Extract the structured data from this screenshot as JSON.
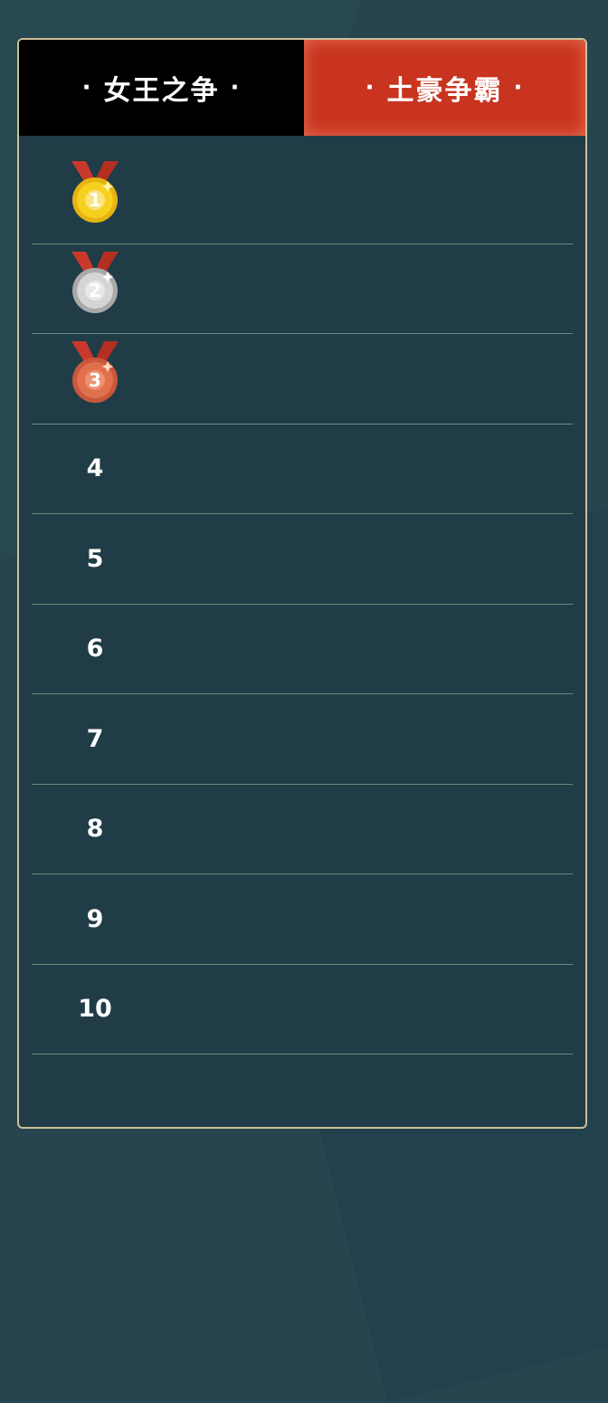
{
  "tabs": [
    {
      "label": "女王之争",
      "active": false
    },
    {
      "label": "土豪争霸",
      "active": true
    }
  ],
  "tab_dot": "·",
  "colors": {
    "page_bg": "#27454f",
    "panel_bg": "#1f3c47",
    "panel_border": "#cdbf97",
    "tab_inactive_bg": "#000000",
    "tab_active_bg": "#c8341f",
    "divider": "#6f8a7c",
    "gold": "#f6cf1f",
    "silver": "#cfcfcf",
    "bronze": "#e0704e",
    "ribbon": "#c9392b"
  },
  "ranking": {
    "rows": [
      {
        "rank": "1",
        "medal": "gold-medal-icon"
      },
      {
        "rank": "2",
        "medal": "silver-medal-icon"
      },
      {
        "rank": "3",
        "medal": "bronze-medal-icon"
      },
      {
        "rank": "4"
      },
      {
        "rank": "5"
      },
      {
        "rank": "6"
      },
      {
        "rank": "7"
      },
      {
        "rank": "8"
      },
      {
        "rank": "9"
      },
      {
        "rank": "10"
      }
    ]
  }
}
